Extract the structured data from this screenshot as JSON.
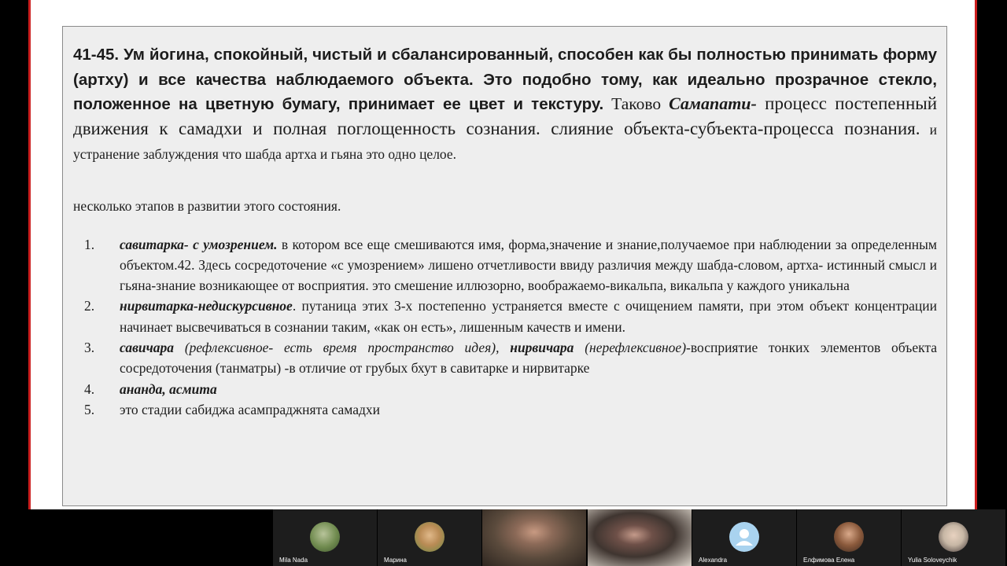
{
  "slide": {
    "para1": {
      "bold": "41-45. Ум йогина, спокойный, чистый и сбалансированный, способен как бы полностью принимать форму (артху) и все качества наблюдаемого объекта. Это подобно тому, как идеально прозрачное стекло, положенное на цветную бумагу, принимает ее цвет и текстуру.",
      "t1": " Таково ",
      "term": "Самапати-",
      "t2": " процесс постепенный движения к самадхи и полная поглощенность сознания. слияние объекта-субъекта-процесса познания.",
      "t3": " и устранение заблуждения что шабда артха и гьяна это одно целое."
    },
    "intro2": "несколько этапов в развитии этого состояния.",
    "stages": [
      {
        "num": "1.",
        "term": "савитарка- с умозрением.",
        "rest": " в котором все еще смешиваются имя, форма,значение и знание,получаемое при наблюдении за определенным объектом.42. Здесь сосредоточение «с умозрением» лишено отчетливости ввиду различия между шабда-словом, артха- истинный смысл и гьяна-знание возникающее от восприятия. это смешение иллюзорно, воображаемо-викальпа, викальпа у каждого уникальна"
      },
      {
        "num": "2.",
        "term": "нирвитарка-недискурсивное",
        "rest": ". путаница этих 3-х постепенно устраняется вместе с очищением памяти, при этом объект концентрации начинает высвечиваться в сознании таким, «как он есть», лишенным качеств и имени."
      },
      {
        "num": "3.",
        "term": "савичара",
        "ital1": " (рефлексивное- есть время пространство идея), ",
        "term2": "нирвичара",
        "ital2": " (нерефлексивное)",
        "rest": "-восприятие тонких элементов объекта сосредоточения (танматры) -в отличие от грубых бхут в савитарке и нирвитарке"
      },
      {
        "num": "4.",
        "term": "ананда, асмита",
        "rest": ""
      },
      {
        "num": "5.",
        "term": "",
        "rest": "это стадии сабиджа асампраджнята самадхи"
      }
    ]
  },
  "participants": [
    {
      "name": "Mila Nada",
      "kind": "photo",
      "color": "#6f8a4e"
    },
    {
      "name": "Марина",
      "kind": "photo",
      "color": "#b98b55"
    },
    {
      "name": "",
      "kind": "video",
      "color": "#5a4a3c"
    },
    {
      "name": "",
      "kind": "video",
      "color": "#3f3530"
    },
    {
      "name": "Alexandra",
      "kind": "default-avatar",
      "color": "#a9d3ef"
    },
    {
      "name": "Елфимова Елена",
      "kind": "photo",
      "color": "#8b5a3c"
    },
    {
      "name": "Yulia Soloveychik",
      "kind": "photo",
      "color": "#c7b7a5"
    }
  ]
}
